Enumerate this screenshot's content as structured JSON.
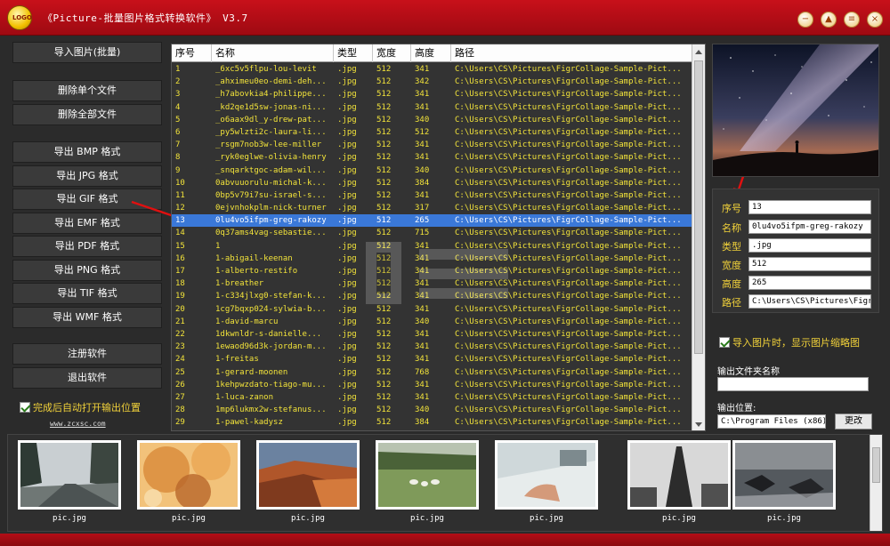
{
  "window": {
    "title": "《Picture-批量图片格式转换软件》 V3.7",
    "logo_text": "LOGO",
    "controls": [
      "−",
      "▲",
      "≡",
      "×"
    ]
  },
  "sidebar": {
    "import_button": "导入图片(批量)",
    "delete_single": "删除单个文件",
    "delete_all": "删除全部文件",
    "export_buttons": [
      "导出 BMP 格式",
      "导出 JPG 格式",
      "导出 GIF 格式",
      "导出 EMF 格式",
      "导出 PDF 格式",
      "导出 PNG 格式",
      "导出 TIF 格式",
      "导出 WMF 格式"
    ],
    "register": "注册软件",
    "exit": "退出软件",
    "auto_open_label": "完成后自动打开输出位置",
    "auto_open_checked": true,
    "site": "www.zcxsc.com"
  },
  "table": {
    "columns": [
      "序号",
      "名称",
      "类型",
      "宽度",
      "高度",
      "路径"
    ],
    "selected_index": 12,
    "rows": [
      [
        "1",
        "_6xc5v5flpu-lou-levit",
        ".jpg",
        "512",
        "341",
        "C:\\Users\\CS\\Pictures\\FigrCollage-Sample-Pict..."
      ],
      [
        "2",
        "_ahximeu0eo-demi-deh...",
        ".jpg",
        "512",
        "342",
        "C:\\Users\\CS\\Pictures\\FigrCollage-Sample-Pict..."
      ],
      [
        "3",
        "_h7abovkia4-philippe...",
        ".jpg",
        "512",
        "341",
        "C:\\Users\\CS\\Pictures\\FigrCollage-Sample-Pict..."
      ],
      [
        "4",
        "_kd2qe1d5sw-jonas-ni...",
        ".jpg",
        "512",
        "341",
        "C:\\Users\\CS\\Pictures\\FigrCollage-Sample-Pict..."
      ],
      [
        "5",
        "_o6aax9dl_y-drew-pat...",
        ".jpg",
        "512",
        "340",
        "C:\\Users\\CS\\Pictures\\FigrCollage-Sample-Pict..."
      ],
      [
        "6",
        "_py5wlzti2c-laura-li...",
        ".jpg",
        "512",
        "512",
        "C:\\Users\\CS\\Pictures\\FigrCollage-Sample-Pict..."
      ],
      [
        "7",
        "_rsgm7nob3w-lee-miller",
        ".jpg",
        "512",
        "341",
        "C:\\Users\\CS\\Pictures\\FigrCollage-Sample-Pict..."
      ],
      [
        "8",
        "_ryk0eglwe-olivia-henry",
        ".jpg",
        "512",
        "341",
        "C:\\Users\\CS\\Pictures\\FigrCollage-Sample-Pict..."
      ],
      [
        "9",
        "_snqarktgoc-adam-wil...",
        ".jpg",
        "512",
        "340",
        "C:\\Users\\CS\\Pictures\\FigrCollage-Sample-Pict..."
      ],
      [
        "10",
        "0abvuuorulu-michal-k...",
        ".jpg",
        "512",
        "384",
        "C:\\Users\\CS\\Pictures\\FigrCollage-Sample-Pict..."
      ],
      [
        "11",
        "0bp5v79i7su-israel-s...",
        ".jpg",
        "512",
        "341",
        "C:\\Users\\CS\\Pictures\\FigrCollage-Sample-Pict..."
      ],
      [
        "12",
        "0ejvnhokplm-nick-turner",
        ".jpg",
        "512",
        "317",
        "C:\\Users\\CS\\Pictures\\FigrCollage-Sample-Pict..."
      ],
      [
        "13",
        "0lu4vo5ifpm-greg-rakozy",
        ".jpg",
        "512",
        "265",
        "C:\\Users\\CS\\Pictures\\FigrCollage-Sample-Pict..."
      ],
      [
        "14",
        "0q37ams4vag-sebastie...",
        ".jpg",
        "512",
        "715",
        "C:\\Users\\CS\\Pictures\\FigrCollage-Sample-Pict..."
      ],
      [
        "15",
        "1",
        ".jpg",
        "512",
        "341",
        "C:\\Users\\CS\\Pictures\\FigrCollage-Sample-Pict..."
      ],
      [
        "16",
        "1-abigail-keenan",
        ".jpg",
        "512",
        "341",
        "C:\\Users\\CS\\Pictures\\FigrCollage-Sample-Pict..."
      ],
      [
        "17",
        "1-alberto-restifo",
        ".jpg",
        "512",
        "341",
        "C:\\Users\\CS\\Pictures\\FigrCollage-Sample-Pict..."
      ],
      [
        "18",
        "1-breather",
        ".jpg",
        "512",
        "341",
        "C:\\Users\\CS\\Pictures\\FigrCollage-Sample-Pict..."
      ],
      [
        "19",
        "1-c334jlxg0-stefan-k...",
        ".jpg",
        "512",
        "341",
        "C:\\Users\\CS\\Pictures\\FigrCollage-Sample-Pict..."
      ],
      [
        "20",
        "1cg7bqxp024-sylwia-b...",
        ".jpg",
        "512",
        "341",
        "C:\\Users\\CS\\Pictures\\FigrCollage-Sample-Pict..."
      ],
      [
        "21",
        "1-david-marcu",
        ".jpg",
        "512",
        "340",
        "C:\\Users\\CS\\Pictures\\FigrCollage-Sample-Pict..."
      ],
      [
        "22",
        "1dkwnldr-s-danielle...",
        ".jpg",
        "512",
        "341",
        "C:\\Users\\CS\\Pictures\\FigrCollage-Sample-Pict..."
      ],
      [
        "23",
        "1ewaod96d3k-jordan-m...",
        ".jpg",
        "512",
        "341",
        "C:\\Users\\CS\\Pictures\\FigrCollage-Sample-Pict..."
      ],
      [
        "24",
        "1-freitas",
        ".jpg",
        "512",
        "341",
        "C:\\Users\\CS\\Pictures\\FigrCollage-Sample-Pict..."
      ],
      [
        "25",
        "1-gerard-moonen",
        ".jpg",
        "512",
        "768",
        "C:\\Users\\CS\\Pictures\\FigrCollage-Sample-Pict..."
      ],
      [
        "26",
        "1kehpwzdato-tiago-mu...",
        ".jpg",
        "512",
        "341",
        "C:\\Users\\CS\\Pictures\\FigrCollage-Sample-Pict..."
      ],
      [
        "27",
        "1-luca-zanon",
        ".jpg",
        "512",
        "341",
        "C:\\Users\\CS\\Pictures\\FigrCollage-Sample-Pict..."
      ],
      [
        "28",
        "1mp6lukmx2w-stefanus...",
        ".jpg",
        "512",
        "340",
        "C:\\Users\\CS\\Pictures\\FigrCollage-Sample-Pict..."
      ],
      [
        "29",
        "1-pawel-kadysz",
        ".jpg",
        "512",
        "384",
        "C:\\Users\\CS\\Pictures\\FigrCollage-Sample-Pict..."
      ]
    ]
  },
  "details": {
    "fields": [
      {
        "label": "序号",
        "value": "13"
      },
      {
        "label": "名称",
        "value": "0lu4vo5ifpm-greg-rakozy"
      },
      {
        "label": "类型",
        "value": ".jpg"
      },
      {
        "label": "宽度",
        "value": "512"
      },
      {
        "label": "高度",
        "value": "265"
      },
      {
        "label": "路径",
        "value": "C:\\Users\\CS\\Pictures\\FigrCollage"
      }
    ],
    "show_thumb_label": "导入图片时，显示图片缩略图",
    "show_thumb_checked": true,
    "output_folder_label": "输出文件夹名称",
    "output_folder_value": "",
    "output_path_label": "输出位置:",
    "output_path_value": "C:\\Program Files (x86)",
    "change_button": "更改"
  },
  "thumbnails": {
    "labels": [
      "pic.jpg",
      "pic.jpg",
      "pic.jpg",
      "pic.jpg",
      "pic.jpg",
      "pic.jpg",
      "pic.jpg"
    ]
  },
  "colors": {
    "titlebar": "#c8101a",
    "row_text": "#f2e33a",
    "selection": "#3a78d8",
    "label_yellow": "#f2d23a"
  }
}
